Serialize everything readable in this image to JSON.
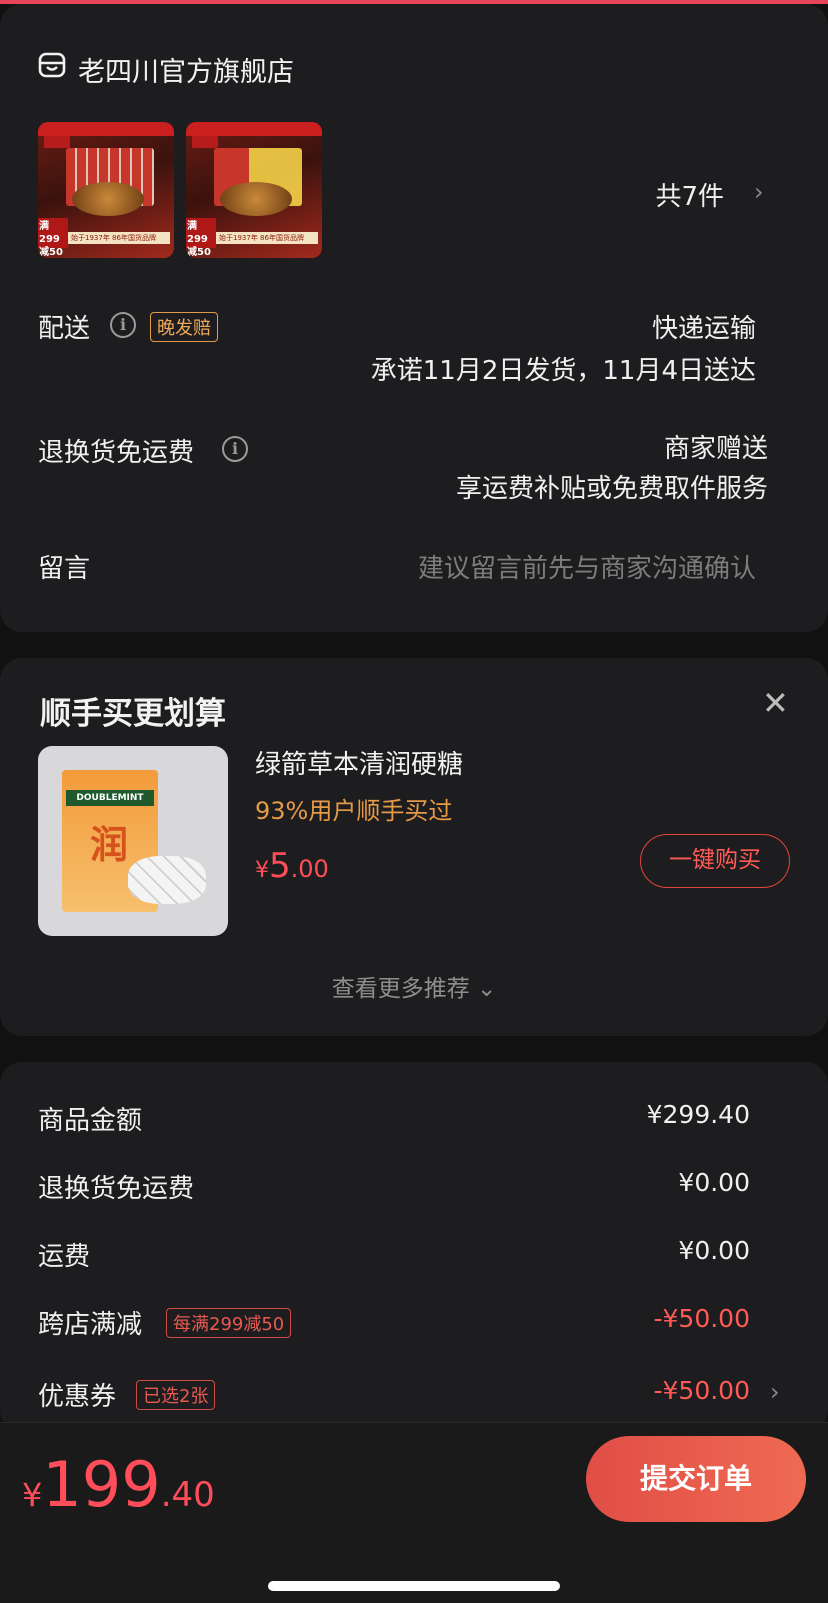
{
  "colors": {
    "background": "#111111",
    "card": "#1d1d1f",
    "accent_red": "#ff4d5a",
    "accent_orange": "#e59a48",
    "top_line": "#e8455a"
  },
  "store": {
    "name": "老四川官方旗舰店",
    "icon": "store-icon",
    "products": [
      {
        "badge": "满299减50",
        "strip": "始于1937年 86年国货品牌"
      },
      {
        "badge": "满299减50",
        "strip": "始于1937年 86年国货品牌"
      }
    ],
    "item_count": "共7件"
  },
  "delivery": {
    "label": "配送",
    "tag": "晚发赔",
    "method": "快递运输",
    "promise": "承诺11月2日发货，11月4日送达"
  },
  "return_shipping": {
    "label": "退换货免运费",
    "value": "商家赠送",
    "sub": "享运费补贴或免费取件服务"
  },
  "message": {
    "label": "留言",
    "placeholder": "建议留言前先与商家沟通确认"
  },
  "recommend": {
    "title": "顺手买更划算",
    "product_name": "绿箭草本清润硬糖",
    "bought_text": "93%用户顺手买过",
    "price_symbol": "¥",
    "price_int": "5",
    "price_dec": ".00",
    "buy_label": "一键购买",
    "more_label": "查看更多推荐",
    "box_brand": "DOUBLEMINT",
    "box_char": "润"
  },
  "price_detail": {
    "rows": [
      {
        "label": "商品金额",
        "value": "¥299.40"
      },
      {
        "label": "退换货免运费",
        "value": "¥0.00"
      },
      {
        "label": "运费",
        "value": "¥0.00"
      },
      {
        "label": "跨店满减",
        "tag": "每满299减50",
        "value": "-¥50.00"
      },
      {
        "label": "优惠券",
        "tag": "已选2张",
        "value": "-¥50.00"
      }
    ]
  },
  "bottom": {
    "currency": "¥",
    "total_int": "199",
    "total_dec": ".40",
    "submit_label": "提交订单"
  }
}
